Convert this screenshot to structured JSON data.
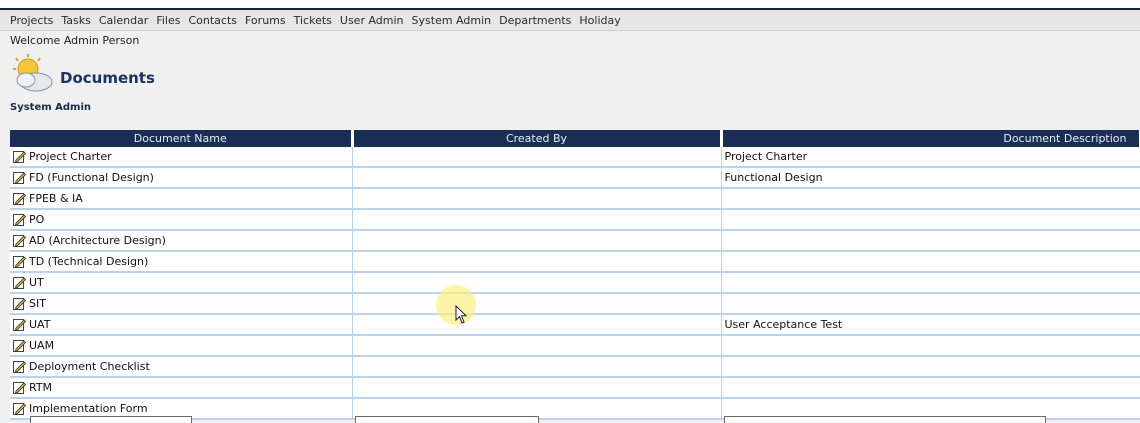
{
  "nav": {
    "items": [
      "Projects",
      "Tasks",
      "Calendar",
      "Files",
      "Contacts",
      "Forums",
      "Tickets",
      "User Admin",
      "System Admin",
      "Departments",
      "Holiday"
    ]
  },
  "welcome": "Welcome Admin Person",
  "page_title": "Documents",
  "section_label": "System Admin",
  "table": {
    "columns": [
      "Document Name",
      "Created By",
      "Document Description"
    ],
    "rows": [
      {
        "name": "Project Charter",
        "created_by": "",
        "description": "Project Charter"
      },
      {
        "name": "FD (Functional Design)",
        "created_by": "",
        "description": "Functional Design"
      },
      {
        "name": "FPEB & IA",
        "created_by": "",
        "description": ""
      },
      {
        "name": "PO",
        "created_by": "",
        "description": ""
      },
      {
        "name": "AD (Architecture Design)",
        "created_by": "",
        "description": ""
      },
      {
        "name": "TD (Technical Design)",
        "created_by": "",
        "description": ""
      },
      {
        "name": "UT",
        "created_by": "",
        "description": ""
      },
      {
        "name": "SIT",
        "created_by": "",
        "description": ""
      },
      {
        "name": "UAT",
        "created_by": "",
        "description": "User Acceptance Test"
      },
      {
        "name": "UAM",
        "created_by": "",
        "description": ""
      },
      {
        "name": "Deployment Checklist",
        "created_by": "",
        "description": ""
      },
      {
        "name": "RTM",
        "created_by": "",
        "description": ""
      },
      {
        "name": "Implementation Form",
        "created_by": "",
        "description": ""
      }
    ]
  },
  "icons": {
    "documents": "documents-sun-icon",
    "edit": "edit-pencil-icon",
    "cursor": "mouse-pointer-icon"
  },
  "colors": {
    "header_bg": "#1b2f56",
    "title": "#1a3264",
    "row_border": "#b9d2ee"
  }
}
